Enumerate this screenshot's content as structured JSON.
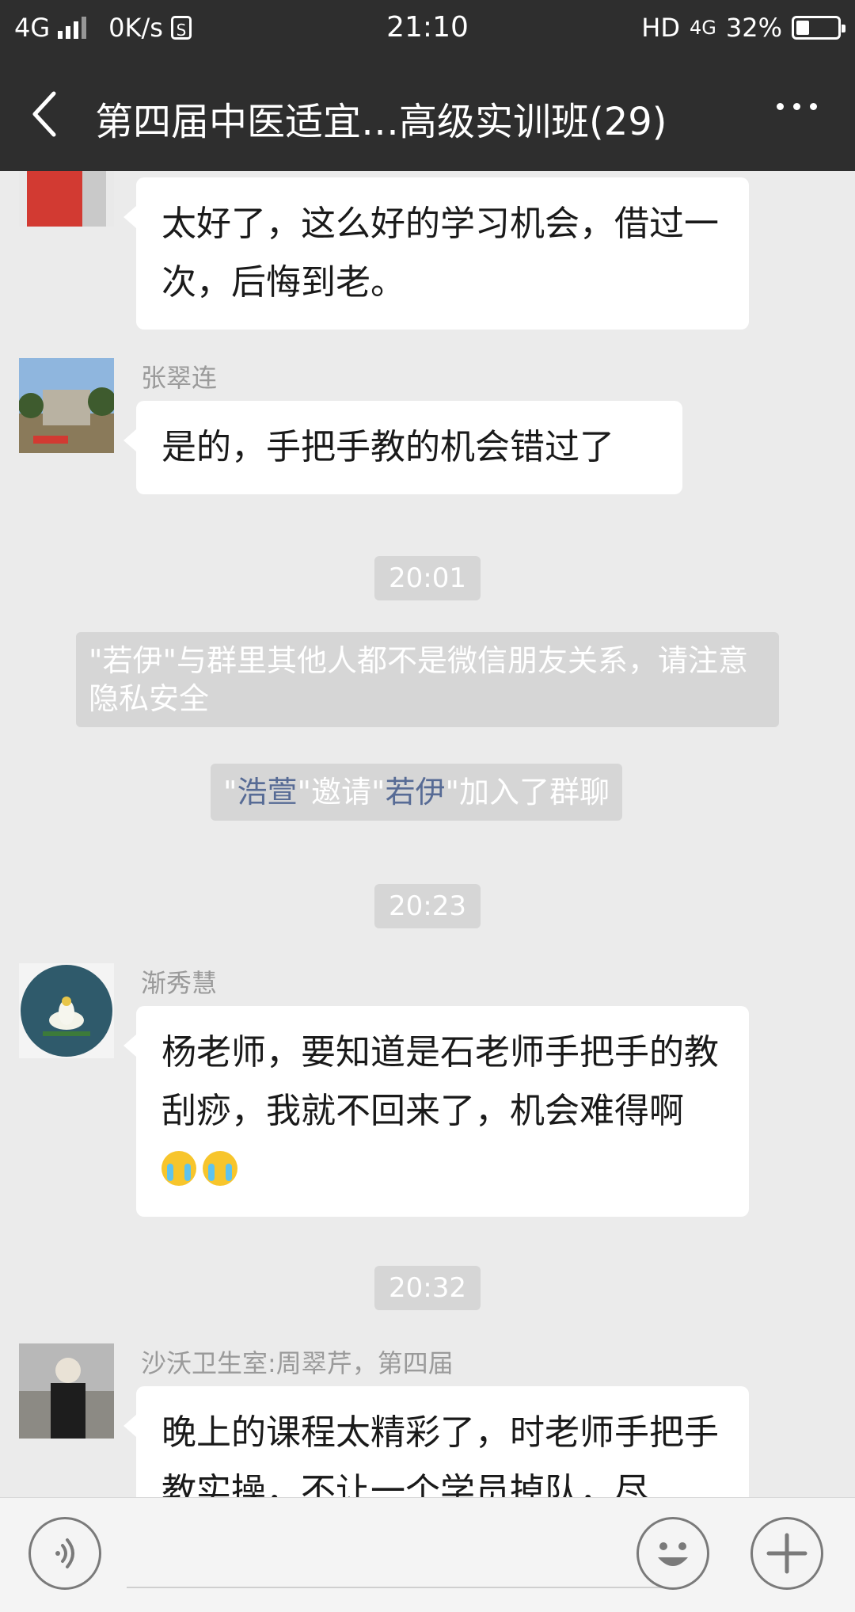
{
  "status_bar": {
    "network": "4G",
    "speed": "0K/s",
    "s_badge": "S",
    "time": "21:10",
    "hd": "HD",
    "net_right": "4G",
    "battery_text": "32%",
    "battery_level": 0.32
  },
  "header": {
    "title": "第四届中医适宜…高级实训班(29)"
  },
  "messages": [
    {
      "lines": "太好了，这么好的学习机会，借过一次，后悔到老。"
    },
    {
      "sender": "张翠连",
      "text": "是的，手把手教的机会错过了"
    },
    {
      "sender": "渐秀慧",
      "text": "杨老师，要知道是石老师手把手的教刮痧，我就不回来了，机会难得啊"
    },
    {
      "sender": "沙沃卫生室:周翠芹，第四届",
      "text": "晚上的课程太精彩了，时老师手把手教实操，不让一个学员掉队，尽"
    }
  ],
  "timestamps": [
    "20:01",
    "20:23",
    "20:32"
  ],
  "system": {
    "privacy_notice": "\"若伊\"与群里其他人都不是微信朋友关系，请注意隐私安全",
    "invite_q1": "\"",
    "invite_name1": "浩萱",
    "invite_mid": "\"邀请\"",
    "invite_name2": "若伊",
    "invite_end": "\"加入了群聊"
  },
  "icons": {
    "back": "chevron-left-icon",
    "more": "more-dots-icon",
    "voice": "voice-icon",
    "emoji": "emoji-icon",
    "plus": "plus-icon"
  },
  "colors": {
    "header_bg": "#2e2e2e",
    "chat_bg": "#ebebeb",
    "link": "#576b95"
  }
}
